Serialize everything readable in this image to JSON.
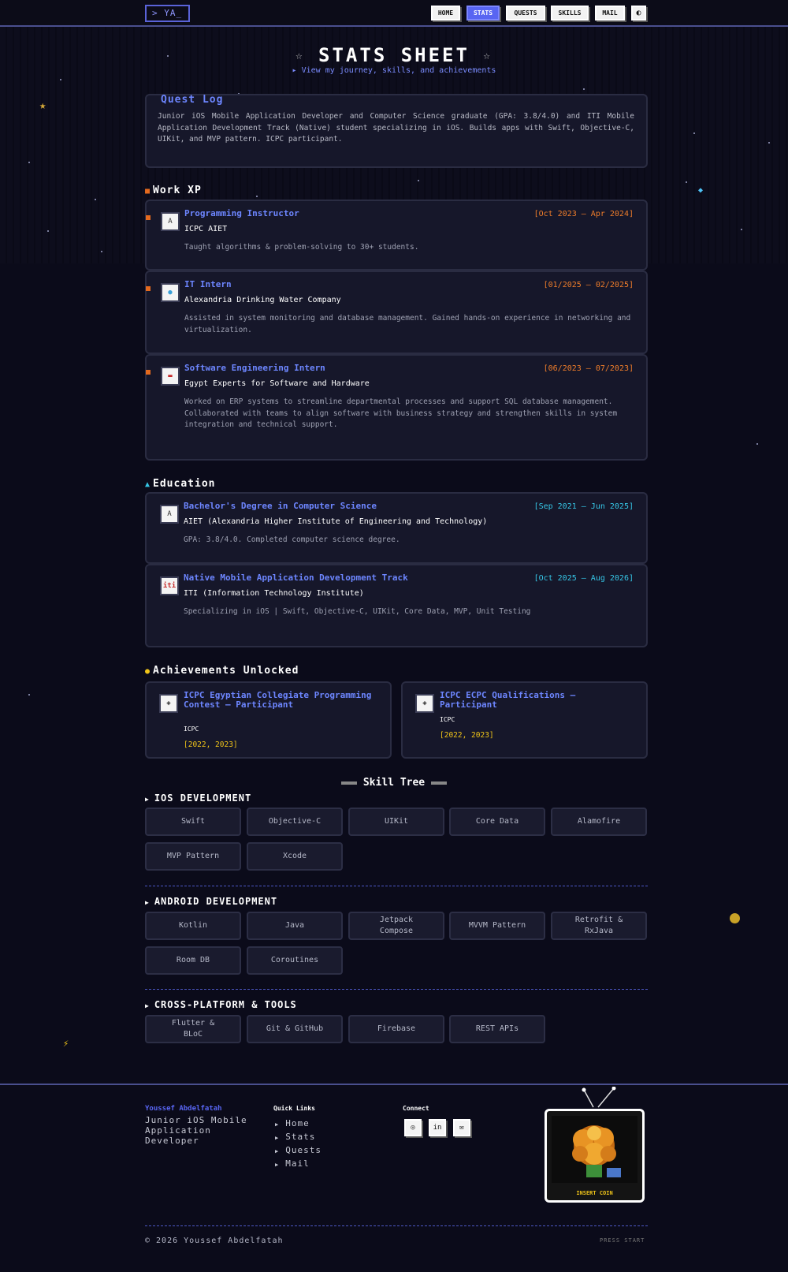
{
  "nav": {
    "logo": "> YA_",
    "items": [
      "HOME",
      "STATS",
      "QUESTS",
      "SKILLS",
      "MAIL"
    ],
    "active": "STATS",
    "theme_toggle_icon": "moon-icon"
  },
  "header": {
    "title": "STATS SHEET",
    "subtitle": "▸ View my journey, skills, and achievements"
  },
  "quest_log": {
    "title": "Quest Log",
    "text": "Junior iOS Mobile Application Developer and Computer Science graduate (GPA: 3.8/4.0) and ITI Mobile Application Development Track (Native) student specializing in iOS. Builds apps with Swift, Objective-C, UIKit, and MVP pattern. ICPC participant."
  },
  "work": {
    "title": "Work XP",
    "entries": [
      {
        "title": "Programming Instructor",
        "date": "[Oct 2023 – Apr 2024]",
        "org": "ICPC AIET",
        "desc": "Taught algorithms & problem-solving to 30+ students."
      },
      {
        "title": "IT Intern",
        "date": "[01/2025 – 02/2025]",
        "org": "Alexandria Drinking Water Company",
        "desc": "Assisted in system monitoring and database management. Gained hands-on experience in networking and virtualization."
      },
      {
        "title": "Software Engineering Intern",
        "date": "[06/2023 – 07/2023]",
        "org": "Egypt Experts for Software and Hardware",
        "desc": "Worked on ERP systems to streamline departmental processes and support SQL database management. Collaborated with teams to align software with business strategy and strengthen skills in system integration and technical support."
      }
    ]
  },
  "education": {
    "title": "Education",
    "entries": [
      {
        "title": "Bachelor's Degree in Computer Science",
        "date": "[Sep 2021 – Jun 2025]",
        "org": "AIET (Alexandria Higher Institute of Engineering and Technology)",
        "desc": "GPA: 3.8/4.0. Completed computer science degree."
      },
      {
        "title": "Native Mobile Application Development Track",
        "date": "[Oct 2025 – Aug 2026]",
        "org": "ITI (Information Technology Institute)",
        "desc": "Specializing in iOS | Swift, Objective-C, UIKit, Core Data, MVP, Unit Testing"
      }
    ]
  },
  "achievements": {
    "title": "Achievements Unlocked",
    "items": [
      {
        "title": "ICPC Egyptian Collegiate Programming Contest – Participant",
        "org": "ICPC",
        "date": "[2022, 2023]"
      },
      {
        "title": "ICPC ECPC Qualifications – Participant",
        "org": "ICPC",
        "date": "[2022, 2023]"
      }
    ]
  },
  "skills": {
    "title": "Skill Tree",
    "categories": [
      {
        "name": "IOS DEVELOPMENT",
        "items": [
          "Swift",
          "Objective-C",
          "UIKit",
          "Core Data",
          "Alamofire",
          "MVP Pattern",
          "Xcode"
        ]
      },
      {
        "name": "ANDROID DEVELOPMENT",
        "items": [
          "Kotlin",
          "Java",
          "Jetpack Compose",
          "MVVM Pattern",
          "Retrofit & RxJava",
          "Room DB",
          "Coroutines"
        ]
      },
      {
        "name": "CROSS-PLATFORM & TOOLS",
        "items": [
          "Flutter & BLoC",
          "Git & GitHub",
          "Firebase",
          "REST APIs"
        ]
      }
    ]
  },
  "footer": {
    "name": "Youssef Abdelfatah",
    "role": "Junior iOS Mobile Application Developer",
    "quick_links_title": "Quick Links",
    "links": [
      "Home",
      "Stats",
      "Quests",
      "Mail"
    ],
    "connect_title": "Connect",
    "socials": [
      "github-icon",
      "linkedin-icon",
      "mail-icon"
    ],
    "arcade_label": "INSERT COIN",
    "copyright": "© 2026 Youssef Abdelfatah",
    "press_start": "PRESS START"
  },
  "colors": {
    "accent": "#5865f2",
    "title_blue": "#6d86ff",
    "work_date": "#ef7d2a",
    "edu_date": "#36c6e6",
    "achievement_date": "#f0c419"
  }
}
